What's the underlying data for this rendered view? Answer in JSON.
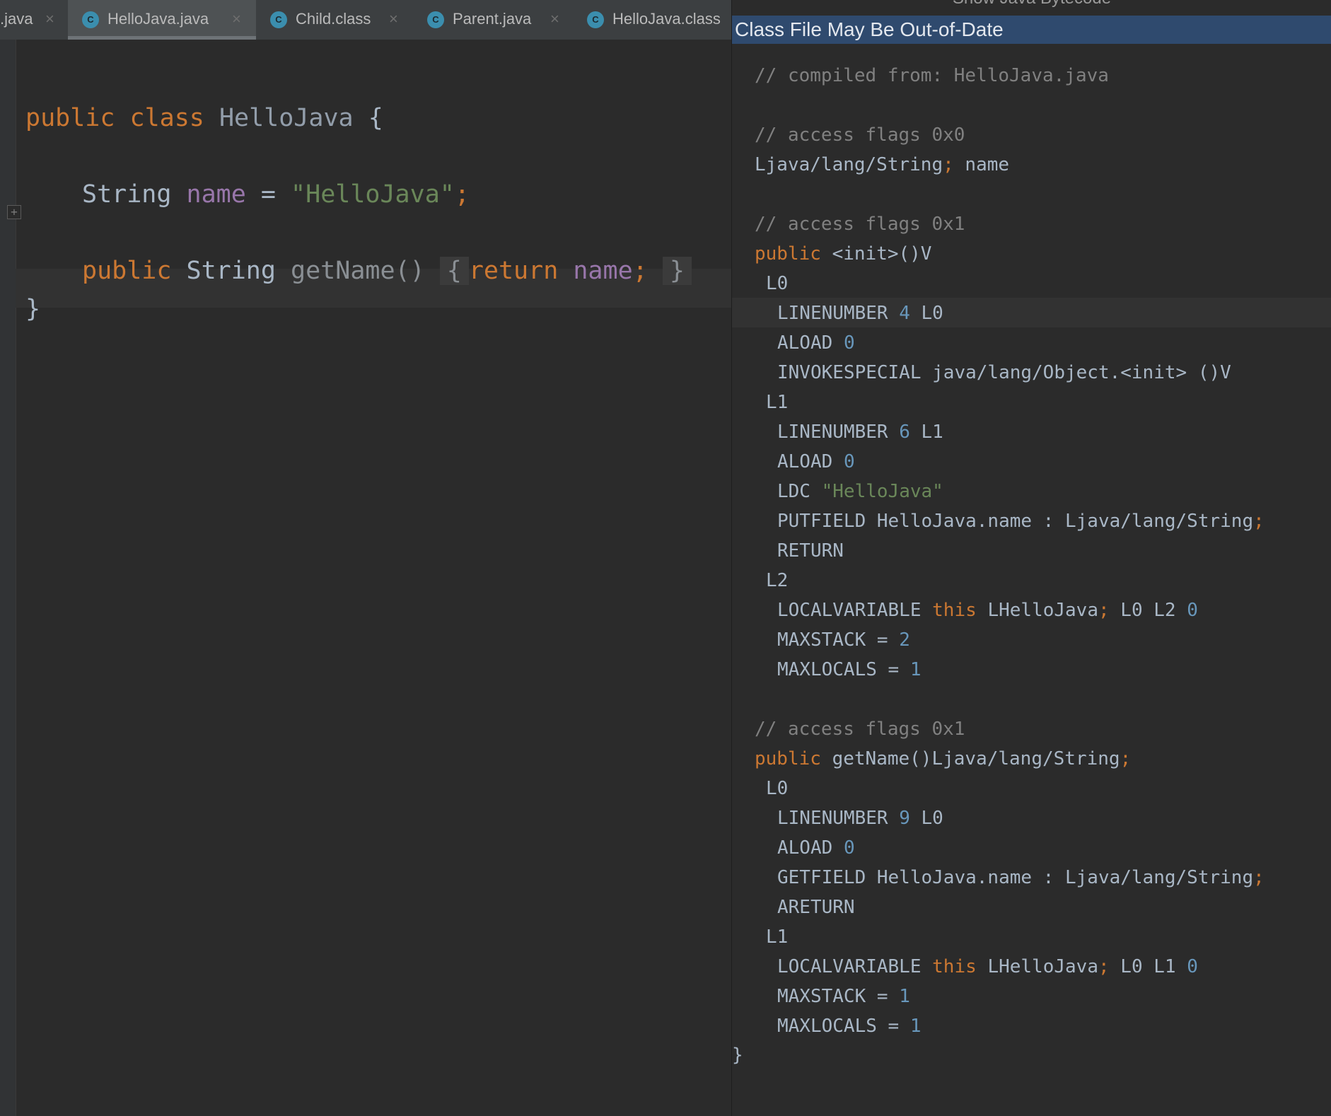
{
  "tabs": [
    {
      "label": ".java",
      "icon": "class-icon",
      "active": false
    },
    {
      "label": "HelloJava.java",
      "icon": "class-icon",
      "active": true
    },
    {
      "label": "Child.class",
      "icon": "class-icon",
      "active": false
    },
    {
      "label": "Parent.java",
      "icon": "class-icon",
      "active": false
    },
    {
      "label": "HelloJava.class",
      "icon": "class-icon",
      "active": false
    }
  ],
  "tab_icon_letter": "C",
  "close_glyph": "×",
  "source": {
    "l1": {
      "kw_public": "public",
      "kw_class": "class",
      "class_name": "HelloJava",
      "open": "{"
    },
    "l2": {
      "type": "String",
      "name": "name",
      "eq": "=",
      "value": "\"HelloJava\"",
      "semi": ";"
    },
    "l3": {
      "kw_public": "public",
      "type": "String",
      "method": "getName()",
      "fold_open": "{",
      "kw_return": "return",
      "name": "name",
      "semi": ";",
      "fold_close": "}"
    },
    "l4": {
      "close": "}"
    },
    "fold_toggle": "+"
  },
  "panel": {
    "title": "Show Java Bytecode",
    "banner": "Class File May Be Out-of-Date"
  },
  "bytecode": {
    "compiled_comment": "// compiled from: HelloJava.java",
    "field_comment": "// access flags 0x0",
    "field_type": "Ljava/lang/String",
    "field_semi": ";",
    "field_name": "name",
    "init_comment": "// access flags 0x1",
    "init_public": "public",
    "init_sig": "<init>()V",
    "init_L0": "L0",
    "init_ln1": {
      "op": "LINENUMBER",
      "num": "4",
      "label": "L0"
    },
    "init_aload1": {
      "op": "ALOAD",
      "num": "0"
    },
    "init_invoke": "INVOKESPECIAL java/lang/Object.<init> ()V",
    "init_L1": "L1",
    "init_ln2": {
      "op": "LINENUMBER",
      "num": "6",
      "label": "L1"
    },
    "init_aload2": {
      "op": "ALOAD",
      "num": "0"
    },
    "init_ldc": {
      "op": "LDC",
      "str": "\"HelloJava\""
    },
    "init_putfield": {
      "text": "PUTFIELD HelloJava.name : Ljava/lang/String",
      "semi": ";"
    },
    "init_return": "RETURN",
    "init_L2": "L2",
    "init_localvar": {
      "op": "LOCALVARIABLE",
      "kw": "this",
      "type": "LHelloJava",
      "semi": ";",
      "range": "L0 L2",
      "num": "0"
    },
    "init_maxstack": {
      "label": "MAXSTACK =",
      "num": "2"
    },
    "init_maxlocals": {
      "label": "MAXLOCALS =",
      "num": "1"
    },
    "get_comment": "// access flags 0x1",
    "get_public": "public",
    "get_sig": "getName()Ljava/lang/String",
    "get_sig_semi": ";",
    "get_L0": "L0",
    "get_ln": {
      "op": "LINENUMBER",
      "num": "9",
      "label": "L0"
    },
    "get_aload": {
      "op": "ALOAD",
      "num": "0"
    },
    "get_getfield": {
      "text": "GETFIELD HelloJava.name : Ljava/lang/String",
      "semi": ";"
    },
    "get_areturn": "ARETURN",
    "get_L1": "L1",
    "get_localvar": {
      "op": "LOCALVARIABLE",
      "kw": "this",
      "type": "LHelloJava",
      "semi": ";",
      "range": "L0 L1",
      "num": "0"
    },
    "get_maxstack": {
      "label": "MAXSTACK =",
      "num": "1"
    },
    "get_maxlocals": {
      "label": "MAXLOCALS =",
      "num": "1"
    },
    "closing_brace": "}"
  },
  "colors": {
    "keyword": "#cc7832",
    "string": "#6a8759",
    "field": "#9876aa",
    "number": "#6897bb",
    "comment": "#808080",
    "banner": "#2f4a6e",
    "tab_icon": "#3b8eae"
  }
}
